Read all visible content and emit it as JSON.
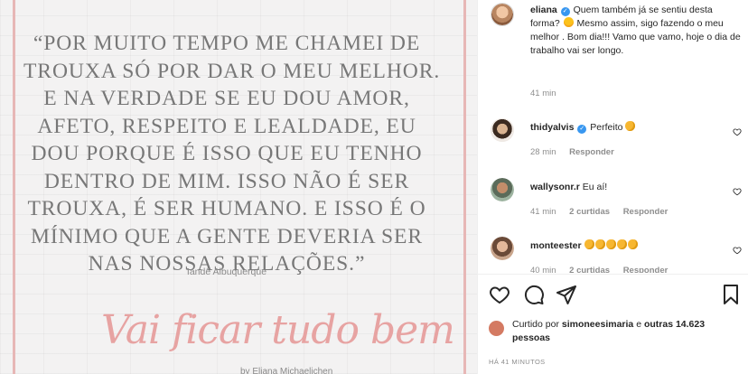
{
  "post_image": {
    "quote_lines": [
      "“Por muito tempo me chamei de",
      "trouxa só por dar o meu melhor.",
      "E na verdade se eu dou amor,",
      "afeto, respeito e lealdade, eu",
      "dou porque é isso que eu tenho",
      "dentro de mim. Isso não é ser",
      "trouxa, é ser humano. E isso é o",
      "mínimo que a gente deveria ser",
      "nas nossas relações.”"
    ],
    "author": "Iandê Albuquerque",
    "script_title": "Vai ficar tudo bem",
    "byline": "by Eliana Michaelichen",
    "colors": {
      "border": "#e7b7b6",
      "script": "#e7a3a2",
      "quote": "#777777"
    }
  },
  "caption": {
    "username": "eliana",
    "text_1": "Quem também já se sentiu desta forma?",
    "text_2": "Mesmo assim, sigo fazendo o meu melhor . Bom dia!!! Vamo que vamo, hoje o dia de trabalho vai ser longo.",
    "time": "41 min"
  },
  "comments": [
    {
      "username": "thidyalvis",
      "verified": true,
      "text": "Perfeito",
      "time": "28 min",
      "likes_label": "",
      "reply_label": "Responder"
    },
    {
      "username": "wallysonr.r",
      "verified": false,
      "text": "Eu aí!",
      "time": "41 min",
      "likes_label": "2 curtidas",
      "reply_label": "Responder"
    },
    {
      "username": "monteester",
      "verified": false,
      "text": "",
      "time": "40 min",
      "likes_label": "2 curtidas",
      "reply_label": "Responder"
    }
  ],
  "actions": {
    "like": "heart-icon",
    "comment": "comment-icon",
    "share": "share-icon",
    "save": "bookmark-icon"
  },
  "likes": {
    "prefix": "Curtido por",
    "user": "simoneesimaria",
    "joiner": "e",
    "others": "outras 14.623 pessoas"
  },
  "timestamp": "HÁ 41 MINUTOS",
  "colors": {
    "verified": "#3897f0",
    "muted": "#8e8e8e",
    "text": "#262626"
  }
}
